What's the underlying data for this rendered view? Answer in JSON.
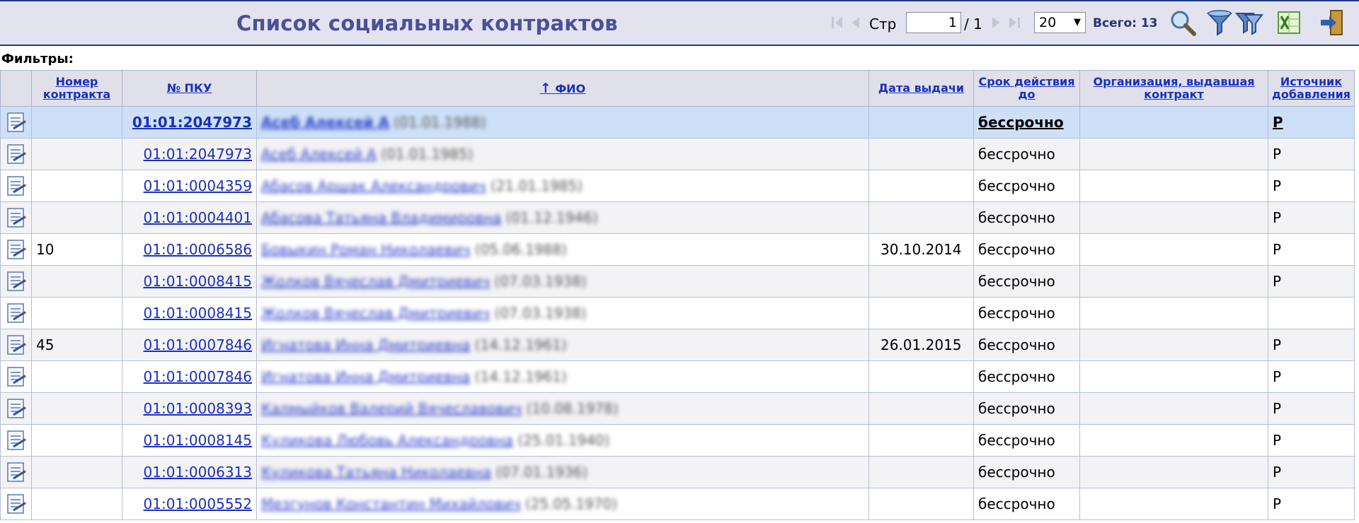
{
  "page": {
    "title": "Список социальных контрактов",
    "filters_label": "Фильтры:"
  },
  "pager": {
    "page_label": "Стр",
    "current_page": "1",
    "total_pages": "/ 1",
    "page_size": "20",
    "total_label": "Всего: 13"
  },
  "toolbar": {
    "icons": [
      "first-page-icon",
      "prev-page-icon",
      "next-page-icon",
      "last-page-icon",
      "search-icon",
      "filter-icon",
      "filter-clear-icon",
      "excel-export-icon",
      "exit-icon"
    ]
  },
  "table": {
    "columns": {
      "contract_no": "Номер контракта",
      "pku": "№ ПКУ",
      "fio_arrow": "↑",
      "fio": "ФИО",
      "issue_date": "Дата выдачи",
      "valid_until": "Срок действия до",
      "org": "Организация, выдавшая контракт",
      "source": "Источник добавления"
    },
    "rows": [
      {
        "contract": "",
        "pku": "01:01:2047973",
        "fio": "Асеб Алексей А",
        "birth": "(01.01.1988)",
        "issue": "",
        "term": "бессрочно",
        "org": "",
        "source": "Р"
      },
      {
        "contract": "",
        "pku": "01:01:2047973",
        "fio": "Асеб Алексей А",
        "birth": "(01.01.1985)",
        "issue": "",
        "term": "бессрочно",
        "org": "",
        "source": "Р"
      },
      {
        "contract": "",
        "pku": "01:01:0004359",
        "fio": "Абасов Аршак Александрович",
        "birth": "(21.01.1985)",
        "issue": "",
        "term": "бессрочно",
        "org": "",
        "source": "Р"
      },
      {
        "contract": "",
        "pku": "01:01:0004401",
        "fio": "Абасова Татьяна Владимировна",
        "birth": "(01.12.1946)",
        "issue": "",
        "term": "бессрочно",
        "org": "",
        "source": "Р"
      },
      {
        "contract": "10",
        "pku": "01:01:0006586",
        "fio": "Бовыкин Роман Николаевич",
        "birth": "(05.06.1988)",
        "issue": "30.10.2014",
        "term": "бессрочно",
        "org": "",
        "source": "Р"
      },
      {
        "contract": "",
        "pku": "01:01:0008415",
        "fio": "Жолков Вячеслав Дмитриевич",
        "birth": "(07.03.1938)",
        "issue": "",
        "term": "бессрочно",
        "org": "",
        "source": "Р"
      },
      {
        "contract": "",
        "pku": "01:01:0008415",
        "fio": "Жолков Вячеслав Дмитриевич",
        "birth": "(07.03.1938)",
        "issue": "",
        "term": "бессрочно",
        "org": "",
        "source": ""
      },
      {
        "contract": "45",
        "pku": "01:01:0007846",
        "fio": "Игнатова Инна Дмитриевна",
        "birth": "(14.12.1961)",
        "issue": "26.01.2015",
        "term": "бессрочно",
        "org": "",
        "source": "Р"
      },
      {
        "contract": "",
        "pku": "01:01:0007846",
        "fio": "Игнатова Инна Дмитриевна",
        "birth": "(14.12.1961)",
        "issue": "",
        "term": "бессрочно",
        "org": "",
        "source": "Р"
      },
      {
        "contract": "",
        "pku": "01:01:0008393",
        "fio": "Калмыйков Валерий Вячеславович",
        "birth": "(10.08.1978)",
        "issue": "",
        "term": "бессрочно",
        "org": "",
        "source": "Р"
      },
      {
        "contract": "",
        "pku": "01:01:0008145",
        "fio": "Куликова Любовь Александровна",
        "birth": "(25.01.1940)",
        "issue": "",
        "term": "бессрочно",
        "org": "",
        "source": "Р"
      },
      {
        "contract": "",
        "pku": "01:01:0006313",
        "fio": "Куликова Татьяна Николаевна",
        "birth": "(07.01.1936)",
        "issue": "",
        "term": "бессрочно",
        "org": "",
        "source": "Р"
      },
      {
        "contract": "",
        "pku": "01:01:0005552",
        "fio": "Мезгунов Константин Михайлович",
        "birth": "(25.05.1970)",
        "issue": "",
        "term": "бессрочно",
        "org": "",
        "source": "Р"
      }
    ]
  }
}
